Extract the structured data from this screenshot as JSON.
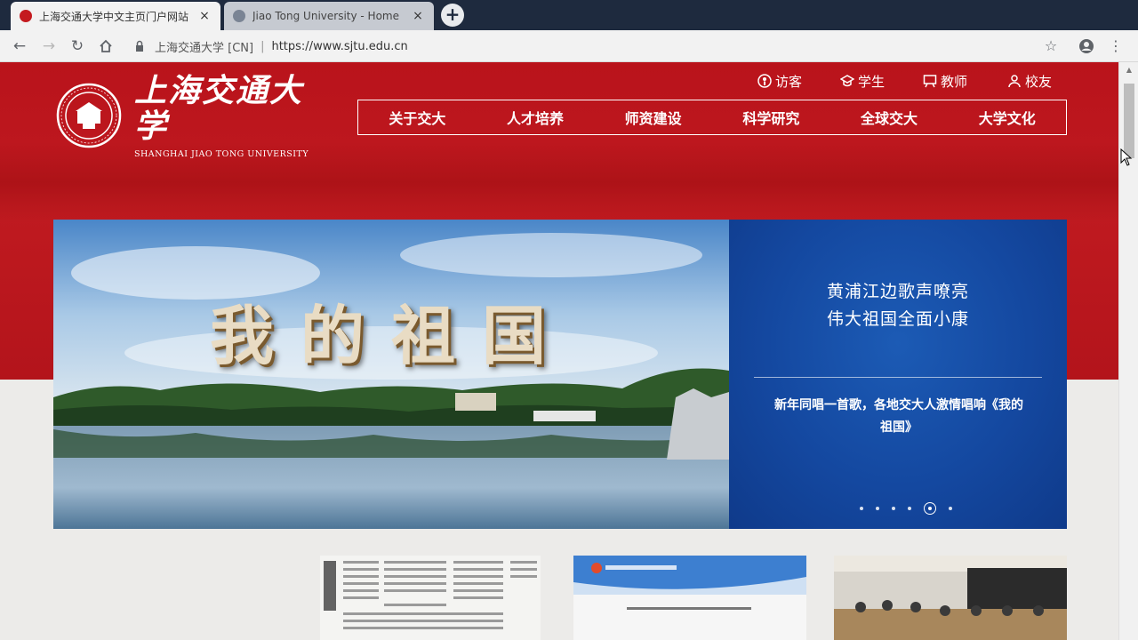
{
  "browser": {
    "tabs": [
      {
        "title": "上海交通大学中文主页门户网站",
        "active": true
      },
      {
        "title": "Jiao Tong University - Home",
        "active": false
      }
    ],
    "new_tab_label": "+",
    "close_label": "×",
    "address": {
      "site": "上海交通大学 [CN]",
      "separator": "|",
      "url": "https://www.sjtu.edu.cn"
    }
  },
  "header": {
    "logo_cn": "上海交通大学",
    "logo_en": "SHANGHAI JIAO TONG UNIVERSITY",
    "quick_links": [
      {
        "label": "访客",
        "icon": "visitor-icon"
      },
      {
        "label": "学生",
        "icon": "student-icon"
      },
      {
        "label": "教师",
        "icon": "teacher-icon"
      },
      {
        "label": "校友",
        "icon": "alumni-icon"
      }
    ],
    "nav": [
      "关于交大",
      "人才培养",
      "师资建设",
      "科学研究",
      "全球交大",
      "大学文化"
    ]
  },
  "banner": {
    "photo_text": "我的祖国",
    "headline_1": "黄浦江边歌声嘹亮",
    "headline_2": "伟大祖国全面小康",
    "description": "新年同唱一首歌，各地交大人激情唱响《我的祖国》",
    "slide_count": 6,
    "active_slide": 5
  },
  "colors": {
    "brand_red": "#b9131b",
    "panel_blue": "#1448a0"
  }
}
